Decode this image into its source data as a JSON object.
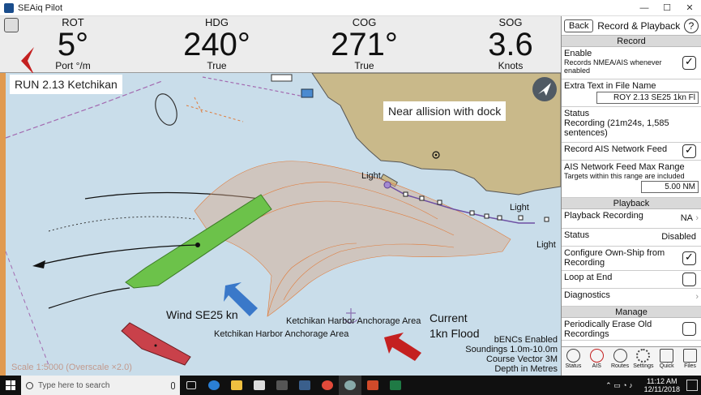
{
  "window": {
    "title": "SEAiq Pilot",
    "controls": [
      "—",
      "☐",
      "✕"
    ]
  },
  "instruments": [
    {
      "label": "ROT",
      "value": "5°",
      "unit": "Port °/m"
    },
    {
      "label": "HDG",
      "value": "240°",
      "unit": "True"
    },
    {
      "label": "COG",
      "value": "271°",
      "unit": "True"
    },
    {
      "label": "SOG",
      "value": "3.6",
      "unit": "Knots"
    }
  ],
  "map": {
    "run_label": "RUN 2.13 Ketchikan",
    "callout": "Near allision with dock",
    "wind_label": "Wind SE25 kn",
    "current_label_1": "Current",
    "current_label_2": "1kn Flood",
    "anchorage_1": "Ketchikan Harbor Anchorage Area",
    "anchorage_2": "Ketchikan Harbor Anchorage Area",
    "light_1": "Light",
    "light_2": "Light",
    "light_3": "Light",
    "info": [
      "bENCs Enabled",
      "Soundings 1.0m-10.0m",
      "Course Vector 3M",
      "Depth in Metres"
    ],
    "scale": "Scale 1:5000 (Overscale ×2.0)",
    "colors": {
      "water": "#c9ddea",
      "land": "#c9b98a",
      "track": "#e8874a",
      "ship": "#6cc24a",
      "wind_arrow": "#3a78c9",
      "current_arrow": "#c42020",
      "rot_arrow": "#c42020"
    }
  },
  "panel": {
    "back": "Back",
    "title": "Record & Playback",
    "help": "?",
    "sections": {
      "record": "Record",
      "playback": "Playback",
      "manage": "Manage"
    },
    "enable_label": "Enable",
    "enable_desc": "Records NMEA/AIS whenever enabled",
    "enable_checked": true,
    "extra_text_label": "Extra Text in File Name",
    "extra_text_value": "ROY 2.13 SE25 1kn Fl",
    "status_label": "Status",
    "status_value": "Recording (21m24s, 1,585 sentences)",
    "record_ais_label": "Record AIS Network Feed",
    "record_ais_checked": true,
    "ais_range_label": "AIS Network Feed Max Range",
    "ais_range_desc": "Targets within this range are included",
    "ais_range_value": "5.00 NM",
    "playback_recording_label": "Playback Recording",
    "playback_recording_value": "NA",
    "pb_status_label": "Status",
    "pb_status_value": "Disabled",
    "configure_label": "Configure Own-Ship from Recording",
    "configure_checked": true,
    "loop_label": "Loop at End",
    "loop_checked": false,
    "diagnostics_label": "Diagnostics",
    "erase_label": "Periodically Erase Old Recordings",
    "erase_checked": false,
    "toolbar": [
      {
        "label": "Status",
        "icon": "status-icon"
      },
      {
        "label": "AIS",
        "icon": "ais-icon"
      },
      {
        "label": "Routes",
        "icon": "routes-icon"
      },
      {
        "label": "Settings",
        "icon": "gear-icon"
      },
      {
        "label": "Quick",
        "icon": "quick-icon"
      },
      {
        "label": "Files",
        "icon": "folder-icon"
      }
    ]
  },
  "taskbar": {
    "search_placeholder": "Type here to search",
    "time": "11:12 AM",
    "date": "12/11/2018"
  }
}
